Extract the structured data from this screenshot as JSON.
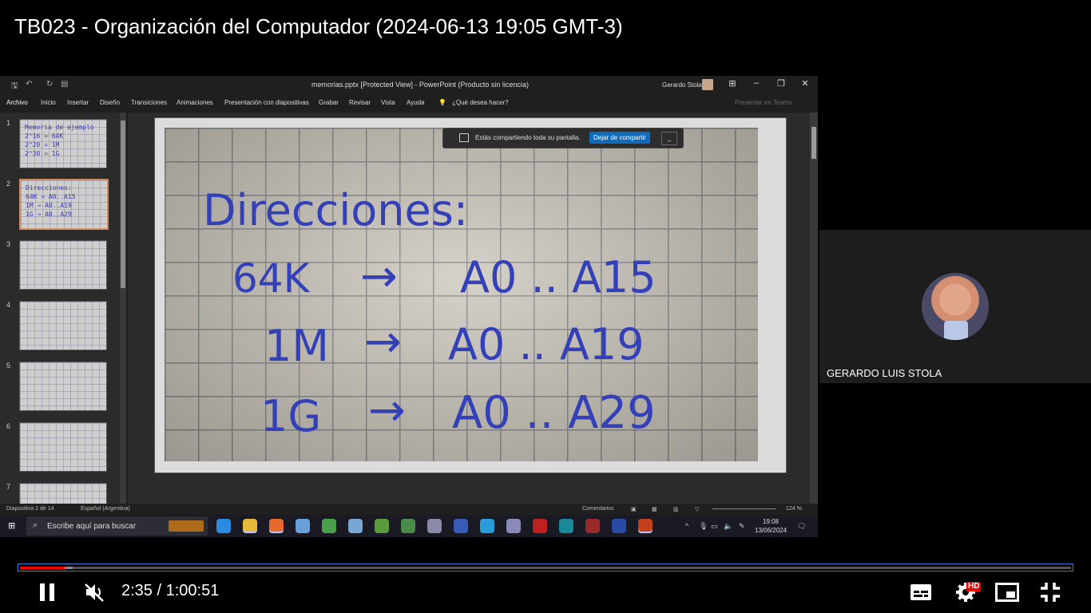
{
  "player": {
    "title": "TB023 - Organización del Computador (2024-06-13 19:05 GMT-3)",
    "time_display": "2:35 / 1:00:51",
    "played_fraction": 0.0425,
    "buffered_fraction": 0.05,
    "hd_label": "HD",
    "icons": [
      "pause-icon",
      "muted-volume-icon",
      "subtitles-icon",
      "settings-icon",
      "miniplayer-icon",
      "exit-fullscreen-icon"
    ]
  },
  "powerpoint": {
    "title": "memorias.pptx [Protected View]  -  PowerPoint (Producto sin licencia)",
    "user": "Gerardo Stola",
    "ribbon": [
      "Archivo",
      "Inicio",
      "Insertar",
      "Diseño",
      "Transiciones",
      "Animaciones",
      "Presentación con diapositivas",
      "Grabar",
      "Revisar",
      "Vista",
      "Ayuda"
    ],
    "tell_me": "¿Qué desea hacer?",
    "present_in_teams": "Presentar en Teams",
    "thumbnails": [
      {
        "number": "1",
        "text": "Memoria de ejemplo\n2^16 = 64K\n2^20 = 1M\n2^30 = 1G"
      },
      {
        "number": "2",
        "text": "Direcciones:\n64K → A0..A15\n1M → A0..A19\n1G → A0..A29"
      },
      {
        "number": "3",
        "text": ""
      },
      {
        "number": "4",
        "text": ""
      },
      {
        "number": "5",
        "text": ""
      },
      {
        "number": "6",
        "text": ""
      },
      {
        "number": "7",
        "text": ""
      }
    ],
    "slide": {
      "heading": "Direcciones:",
      "rows": [
        {
          "size": "64K",
          "arrow": "→",
          "range": "A0 .. A15"
        },
        {
          "size": "1M",
          "arrow": "→",
          "range": "A0 .. A19"
        },
        {
          "size": "1G",
          "arrow": "→",
          "range": "A0 .. A29"
        }
      ]
    },
    "sharing_bar": {
      "text": "Estás compartiendo toda su pantalla.",
      "stop_label": "Dejar de compartir",
      "minimize_label": "_"
    },
    "status": {
      "slide_info": "Diapositiva 2 de 14",
      "language": "Español (Argentina)",
      "comments": "Comentarios",
      "zoom": "124 %"
    }
  },
  "taskbar": {
    "search_placeholder": "Escribe aquí para buscar",
    "time": "19:08",
    "date": "13/06/2024",
    "apps": [
      {
        "name": "edge",
        "color": "#2b8be0",
        "running": false
      },
      {
        "name": "file-explorer",
        "color": "#e8b93a",
        "running": true
      },
      {
        "name": "firefox",
        "color": "#e56a2a",
        "running": true
      },
      {
        "name": "app-globe",
        "color": "#6aa0d8",
        "running": false
      },
      {
        "name": "chrome",
        "color": "#4aa04a",
        "running": false
      },
      {
        "name": "app-cube",
        "color": "#7aa6d6",
        "running": false
      },
      {
        "name": "app-green",
        "color": "#5a9a3a",
        "running": false
      },
      {
        "name": "app-tools",
        "color": "#4a8a4a",
        "running": false
      },
      {
        "name": "app-drive",
        "color": "#8a8aa8",
        "running": false
      },
      {
        "name": "app-arrows",
        "color": "#3a5ab8",
        "running": false
      },
      {
        "name": "telegram",
        "color": "#2a9ad8",
        "running": false
      },
      {
        "name": "app-network",
        "color": "#8a8ab8",
        "running": false
      },
      {
        "name": "filezilla",
        "color": "#c02020",
        "running": false
      },
      {
        "name": "arduino",
        "color": "#1a8a9a",
        "running": false
      },
      {
        "name": "app-bug",
        "color": "#9a2a2a",
        "running": false
      },
      {
        "name": "powershell",
        "color": "#2a4aa8",
        "running": false
      },
      {
        "name": "powerpoint",
        "color": "#c4401a",
        "running": true
      }
    ]
  },
  "participant": {
    "name": "GERARDO LUIS STOLA"
  }
}
